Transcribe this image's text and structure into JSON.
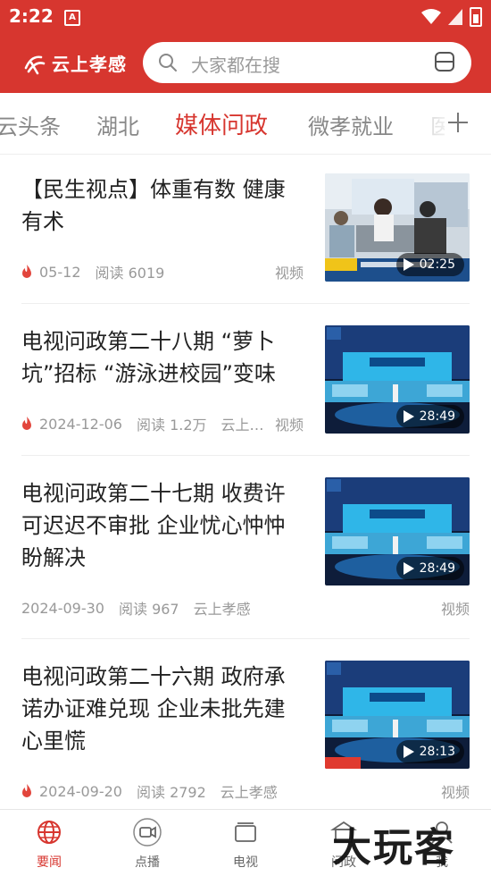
{
  "status_bar": {
    "time": "2:22",
    "notification_glyph": "A"
  },
  "header": {
    "brand_name": "云上孝感",
    "brand_color": "#d7362f",
    "search_placeholder": "大家都在搜"
  },
  "tabs": {
    "items": [
      {
        "label": "云头条"
      },
      {
        "label": "湖北"
      },
      {
        "label": "媒体问政",
        "active": true
      },
      {
        "label": "微孝就业"
      },
      {
        "label": "医"
      }
    ]
  },
  "articles": [
    {
      "title": "【民生视点】体重有数 健康有术",
      "date": "05-12",
      "reads": "阅读 6019",
      "source": "",
      "tag": "视频",
      "duration": "02:25",
      "hot": true
    },
    {
      "title": "电视问政第二十八期 “萝卜坑”招标 “游泳进校园”变味",
      "date": "2024-12-06",
      "reads": "阅读 1.2万",
      "source": "云上…",
      "tag": "视频",
      "duration": "28:49",
      "hot": true
    },
    {
      "title": "电视问政第二十七期 收费许可迟迟不审批 企业忧心忡忡盼解决",
      "date": "2024-09-30",
      "reads": "阅读 967",
      "source": "云上孝感",
      "tag": "视频",
      "duration": "28:49",
      "hot": false
    },
    {
      "title": "电视问政第二十六期 政府承诺办证难兑现 企业未批先建心里慌",
      "date": "2024-09-20",
      "reads": "阅读 2792",
      "source": "云上孝感",
      "tag": "视频",
      "duration": "28:13",
      "hot": true
    }
  ],
  "bottom_nav": {
    "items": [
      {
        "label": "要闻",
        "icon": "globe-icon",
        "active": true
      },
      {
        "label": "点播",
        "icon": "video-camera-icon"
      },
      {
        "label": "电视",
        "icon": "tv-icon"
      },
      {
        "label": "问政",
        "icon": "building-icon"
      },
      {
        "label": "我",
        "icon": "profile-icon"
      }
    ]
  },
  "watermark": "大玩客"
}
